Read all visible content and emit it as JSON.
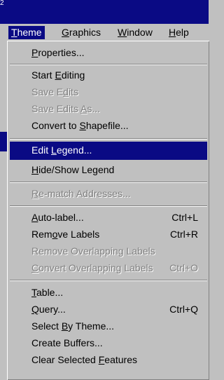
{
  "window": {
    "corner_mark": "2"
  },
  "menubar": {
    "items": [
      {
        "label": "Theme",
        "mnemonic_index": 0
      },
      {
        "label": "Graphics",
        "mnemonic_index": 0
      },
      {
        "label": "Window",
        "mnemonic_index": 0
      },
      {
        "label": "Help",
        "mnemonic_index": 0
      }
    ]
  },
  "menu": {
    "items": [
      {
        "label": "Properties...",
        "mnemonic": "P",
        "shortcut": "",
        "enabled": true
      },
      {
        "label": "Start Editing",
        "mnemonic": "E",
        "shortcut": "",
        "enabled": true
      },
      {
        "label": "Save Edits",
        "mnemonic": "d",
        "shortcut": "",
        "enabled": false
      },
      {
        "label": "Save Edits As...",
        "mnemonic": "A",
        "shortcut": "",
        "enabled": false
      },
      {
        "label": "Convert to Shapefile...",
        "mnemonic": "S",
        "shortcut": "",
        "enabled": true
      },
      {
        "label": "Edit Legend...",
        "mnemonic": "L",
        "shortcut": "",
        "enabled": true,
        "highlighted": true
      },
      {
        "label": "Hide/Show Legend",
        "mnemonic": "H",
        "shortcut": "",
        "enabled": true
      },
      {
        "label": "Re-match Addresses...",
        "mnemonic": "R",
        "shortcut": "",
        "enabled": false
      },
      {
        "label": "Auto-label...",
        "mnemonic": "A",
        "shortcut": "Ctrl+L",
        "enabled": true
      },
      {
        "label": "Remove Labels",
        "mnemonic": "o",
        "shortcut": "Ctrl+R",
        "enabled": true
      },
      {
        "label": "Remove Overlapping Labels",
        "mnemonic": "g",
        "shortcut": "",
        "enabled": false
      },
      {
        "label": "Convert Overlapping Labels",
        "mnemonic": "C",
        "shortcut": "Ctrl+O",
        "enabled": false
      },
      {
        "label": "Table...",
        "mnemonic": "T",
        "shortcut": "",
        "enabled": true
      },
      {
        "label": "Query...",
        "mnemonic": "Q",
        "shortcut": "Ctrl+Q",
        "enabled": true
      },
      {
        "label": "Select By Theme...",
        "mnemonic": "B",
        "shortcut": "",
        "enabled": true
      },
      {
        "label": "Create Buffers...",
        "mnemonic": "",
        "shortcut": "",
        "enabled": true
      },
      {
        "label": "Clear Selected Features",
        "mnemonic": "F",
        "shortcut": "",
        "enabled": true
      }
    ]
  },
  "colors": {
    "highlight": "#0a0a84",
    "menu_bg": "#c0c0c0",
    "disabled_text": "#808080"
  }
}
